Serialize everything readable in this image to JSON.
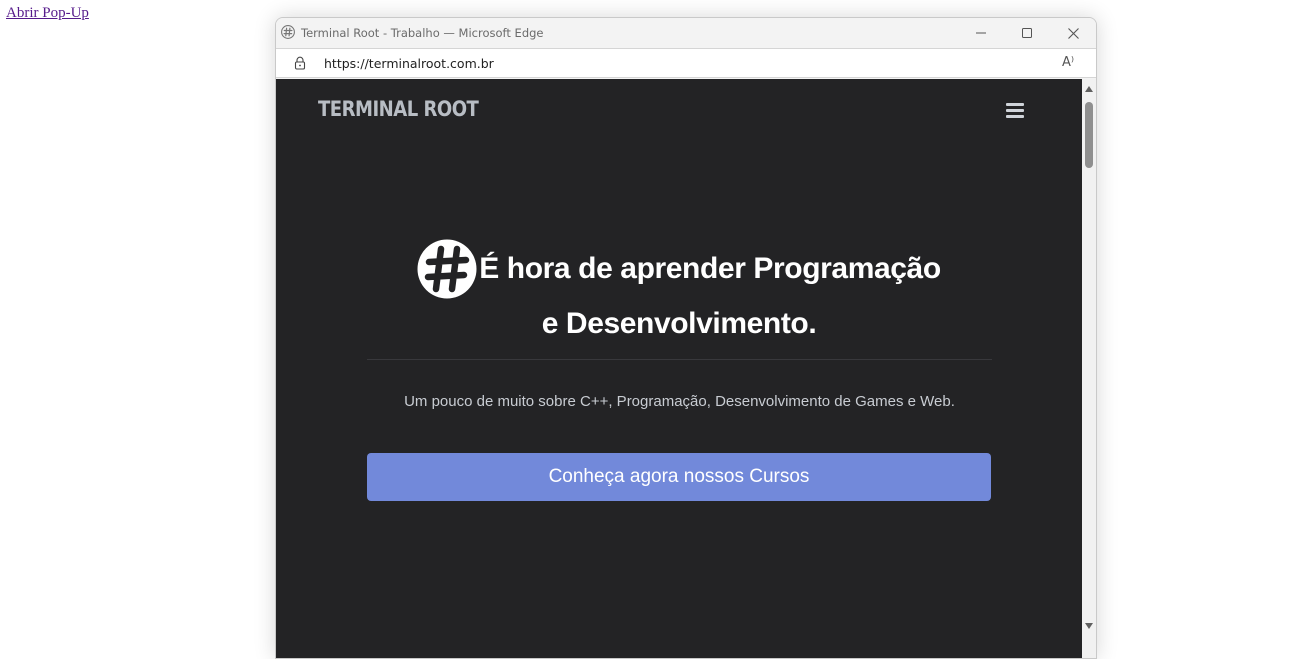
{
  "page": {
    "popup_link": "Abrir Pop-Up"
  },
  "window": {
    "title": "Terminal Root - Trabalho — Microsoft Edge",
    "url": "https://terminalroot.com.br",
    "read_aloud_label": "A⁾",
    "icons": [
      "app-hash-icon",
      "minimize-icon",
      "maximize-icon",
      "close-icon",
      "lock-icon",
      "read-aloud-icon"
    ]
  },
  "site": {
    "brand": "TERMINAL ROOT",
    "nav_icon": "hamburger-menu-icon",
    "hero": {
      "title": "É hora de aprender Programação e Desenvolvimento.",
      "subtitle": "Um pouco de muito sobre C++, Programação, Desenvolvimento de Games e Web.",
      "cta_label": "Conheça agora nossos Cursos"
    }
  },
  "colors": {
    "site_background": "#232325",
    "cta_background": "#7289da",
    "brand_text": "#b8bdc4",
    "link": "#551a8b"
  }
}
